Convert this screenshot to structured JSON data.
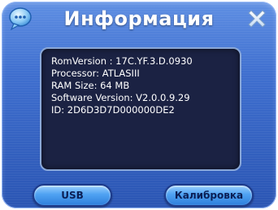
{
  "window": {
    "title": "Информация"
  },
  "info": {
    "lines": [
      "RomVersion : 17C.YF.3.D.0930",
      "Processor: ATLASIII",
      "RAM Size: 64 MB",
      "Software Version: V2.0.0.9.29",
      "ID: 2D6D3D7D000000DE2"
    ]
  },
  "buttons": {
    "usb_label": "USB",
    "calibration_label": "Калибровка"
  },
  "icons": {
    "app": "chat-bubble-icon",
    "close": "close-icon"
  },
  "colors": {
    "window_top": "#5f8fe3",
    "window_bottom": "#2a55b3",
    "panel_bg": "#1b2243",
    "button_top": "#9ad0ff",
    "button_bottom": "#2e7fdc"
  }
}
